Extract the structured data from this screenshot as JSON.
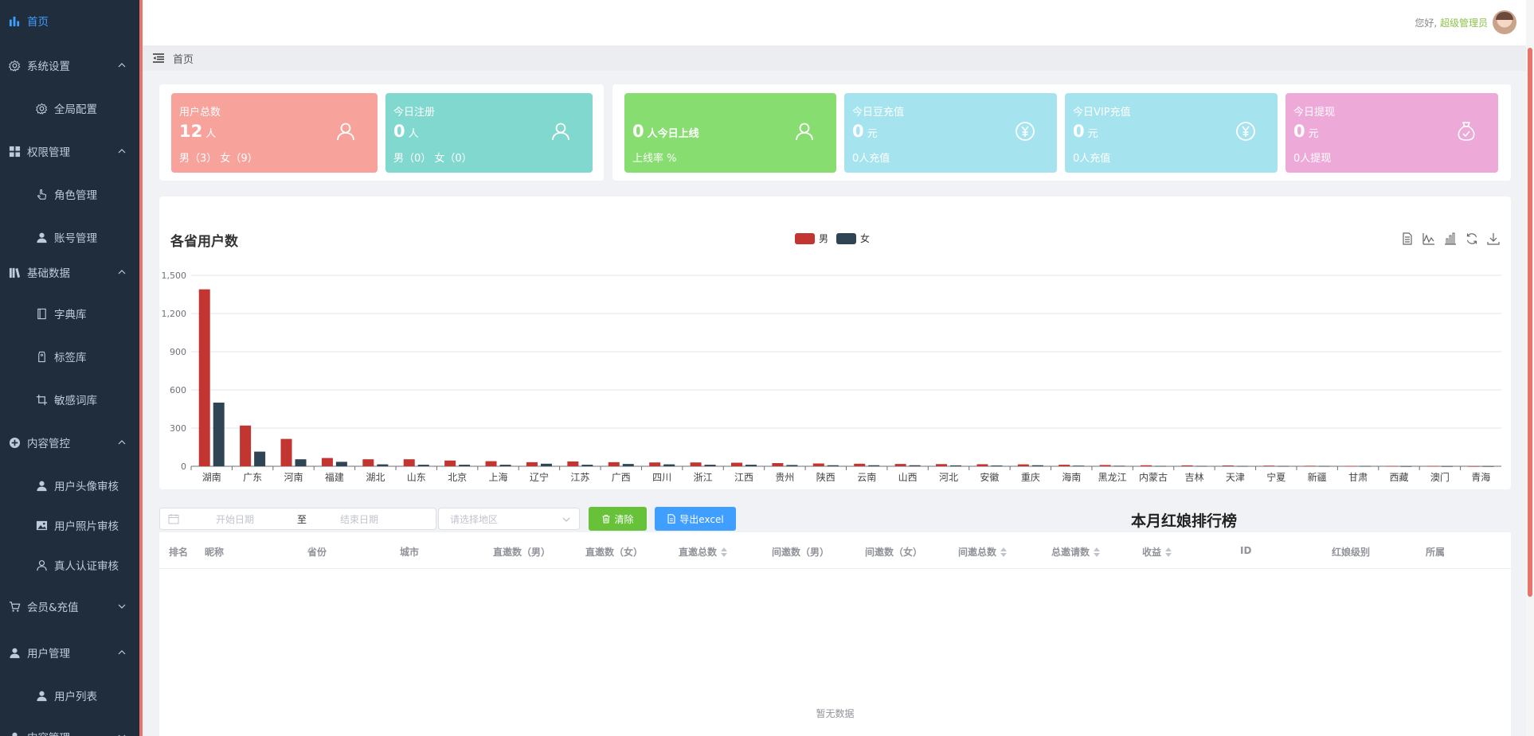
{
  "sidebar": {
    "items": [
      {
        "label": "首页",
        "level": "top",
        "icon": "bar-chart-icon",
        "active": true,
        "arrow": ""
      },
      {
        "label": "系统设置",
        "level": "top",
        "icon": "gear-icon",
        "arrow": "up"
      },
      {
        "label": "全局配置",
        "level": "sub",
        "icon": "gear-icon"
      },
      {
        "label": "权限管理",
        "level": "top",
        "icon": "grid-icon",
        "arrow": "up"
      },
      {
        "label": "角色管理",
        "level": "sub",
        "icon": "hand-pointer-icon"
      },
      {
        "label": "账号管理",
        "level": "sub",
        "icon": "user-icon"
      },
      {
        "label": "基础数据",
        "level": "top",
        "icon": "books-icon",
        "arrow": "up"
      },
      {
        "label": "字典库",
        "level": "sub",
        "icon": "book-icon"
      },
      {
        "label": "标签库",
        "level": "sub",
        "icon": "tag-icon"
      },
      {
        "label": "敏感词库",
        "level": "sub",
        "icon": "crop-icon"
      },
      {
        "label": "内容管控",
        "level": "top",
        "icon": "plus-circle-icon",
        "arrow": "up"
      },
      {
        "label": "用户头像审核",
        "level": "sub",
        "icon": "user-icon"
      },
      {
        "label": "用户照片审核",
        "level": "sub",
        "icon": "image-icon"
      },
      {
        "label": "真人认证审核",
        "level": "sub",
        "icon": "user-outline-icon"
      },
      {
        "label": "会员&充值",
        "level": "top",
        "icon": "cart-icon",
        "arrow": "down"
      },
      {
        "label": "用户管理",
        "level": "top",
        "icon": "user-icon",
        "arrow": "up"
      },
      {
        "label": "用户列表",
        "level": "sub",
        "icon": "user-icon"
      },
      {
        "label": "内容管理",
        "level": "top",
        "icon": "user-icon",
        "arrow": "down"
      }
    ]
  },
  "header": {
    "greeting": "您好,",
    "username": "超级管理员"
  },
  "breadcrumb": {
    "current": "首页"
  },
  "cards": {
    "total_users": {
      "label": "用户总数",
      "value": "12",
      "unit": "人",
      "sub": "男（3）  女（9）",
      "color": "#f8a29c"
    },
    "today_register": {
      "label": "今日注册",
      "value": "0",
      "unit": "人",
      "sub": "男（0）  女（0）",
      "color": "#80d8ce"
    },
    "today_online": {
      "value": "0",
      "unit": "人今日上线",
      "sub": "上线率 %",
      "color": "#88dd70"
    },
    "today_bean": {
      "label": "今日豆充值",
      "value": "0",
      "unit": "元",
      "sub": "0人充值",
      "color": "#a5e4ef"
    },
    "today_vip": {
      "label": "今日VIP充值",
      "value": "0",
      "unit": "元",
      "sub": "0人充值",
      "color": "#a5e4ef"
    },
    "today_withdraw": {
      "label": "今日提现",
      "value": "0",
      "unit": "元",
      "sub": "0人提现",
      "color": "#edaad8"
    }
  },
  "chart_data": {
    "type": "bar",
    "title": "各省用户数",
    "categories": [
      "湖南",
      "广东",
      "河南",
      "福建",
      "湖北",
      "山东",
      "北京",
      "上海",
      "辽宁",
      "江苏",
      "广西",
      "四川",
      "浙江",
      "江西",
      "贵州",
      "陕西",
      "云南",
      "山西",
      "河北",
      "安徽",
      "重庆",
      "海南",
      "黑龙江",
      "内蒙古",
      "吉林",
      "天津",
      "宁夏",
      "新疆",
      "甘肃",
      "西藏",
      "澳门",
      "青海"
    ],
    "series": [
      {
        "name": "男",
        "color": "#c23531",
        "values": [
          1390,
          320,
          215,
          65,
          55,
          55,
          45,
          40,
          32,
          38,
          32,
          30,
          30,
          28,
          25,
          22,
          20,
          18,
          17,
          16,
          15,
          12,
          10,
          8,
          7,
          6,
          5,
          4,
          3,
          2,
          2,
          1
        ]
      },
      {
        "name": "女",
        "color": "#2f4554",
        "values": [
          500,
          115,
          55,
          35,
          15,
          12,
          12,
          12,
          20,
          12,
          18,
          15,
          12,
          12,
          10,
          8,
          8,
          8,
          7,
          6,
          8,
          5,
          4,
          3,
          3,
          2,
          2,
          2,
          2,
          1,
          1,
          1
        ]
      }
    ],
    "ylim": [
      0,
      1500
    ],
    "yticks": [
      "0",
      "300",
      "600",
      "900",
      "1,200",
      "1,500"
    ],
    "grid": true,
    "legend": "top-center"
  },
  "filters": {
    "start_placeholder": "开始日期",
    "separator": "至",
    "end_placeholder": "结束日期",
    "region_placeholder": "请选择地区",
    "clear_label": "清除",
    "export_label": "导出excel"
  },
  "ranking": {
    "title": "本月红娘排行榜",
    "columns": [
      "排名",
      "昵称",
      "省份",
      "城市",
      "直邀数（男）",
      "直邀数（女）",
      "直邀总数",
      "间邀数（男）",
      "间邀数（女）",
      "间邀总数",
      "总邀请数",
      "收益",
      "ID",
      "红娘级别",
      "所属"
    ],
    "empty_text": "暂无数据"
  }
}
